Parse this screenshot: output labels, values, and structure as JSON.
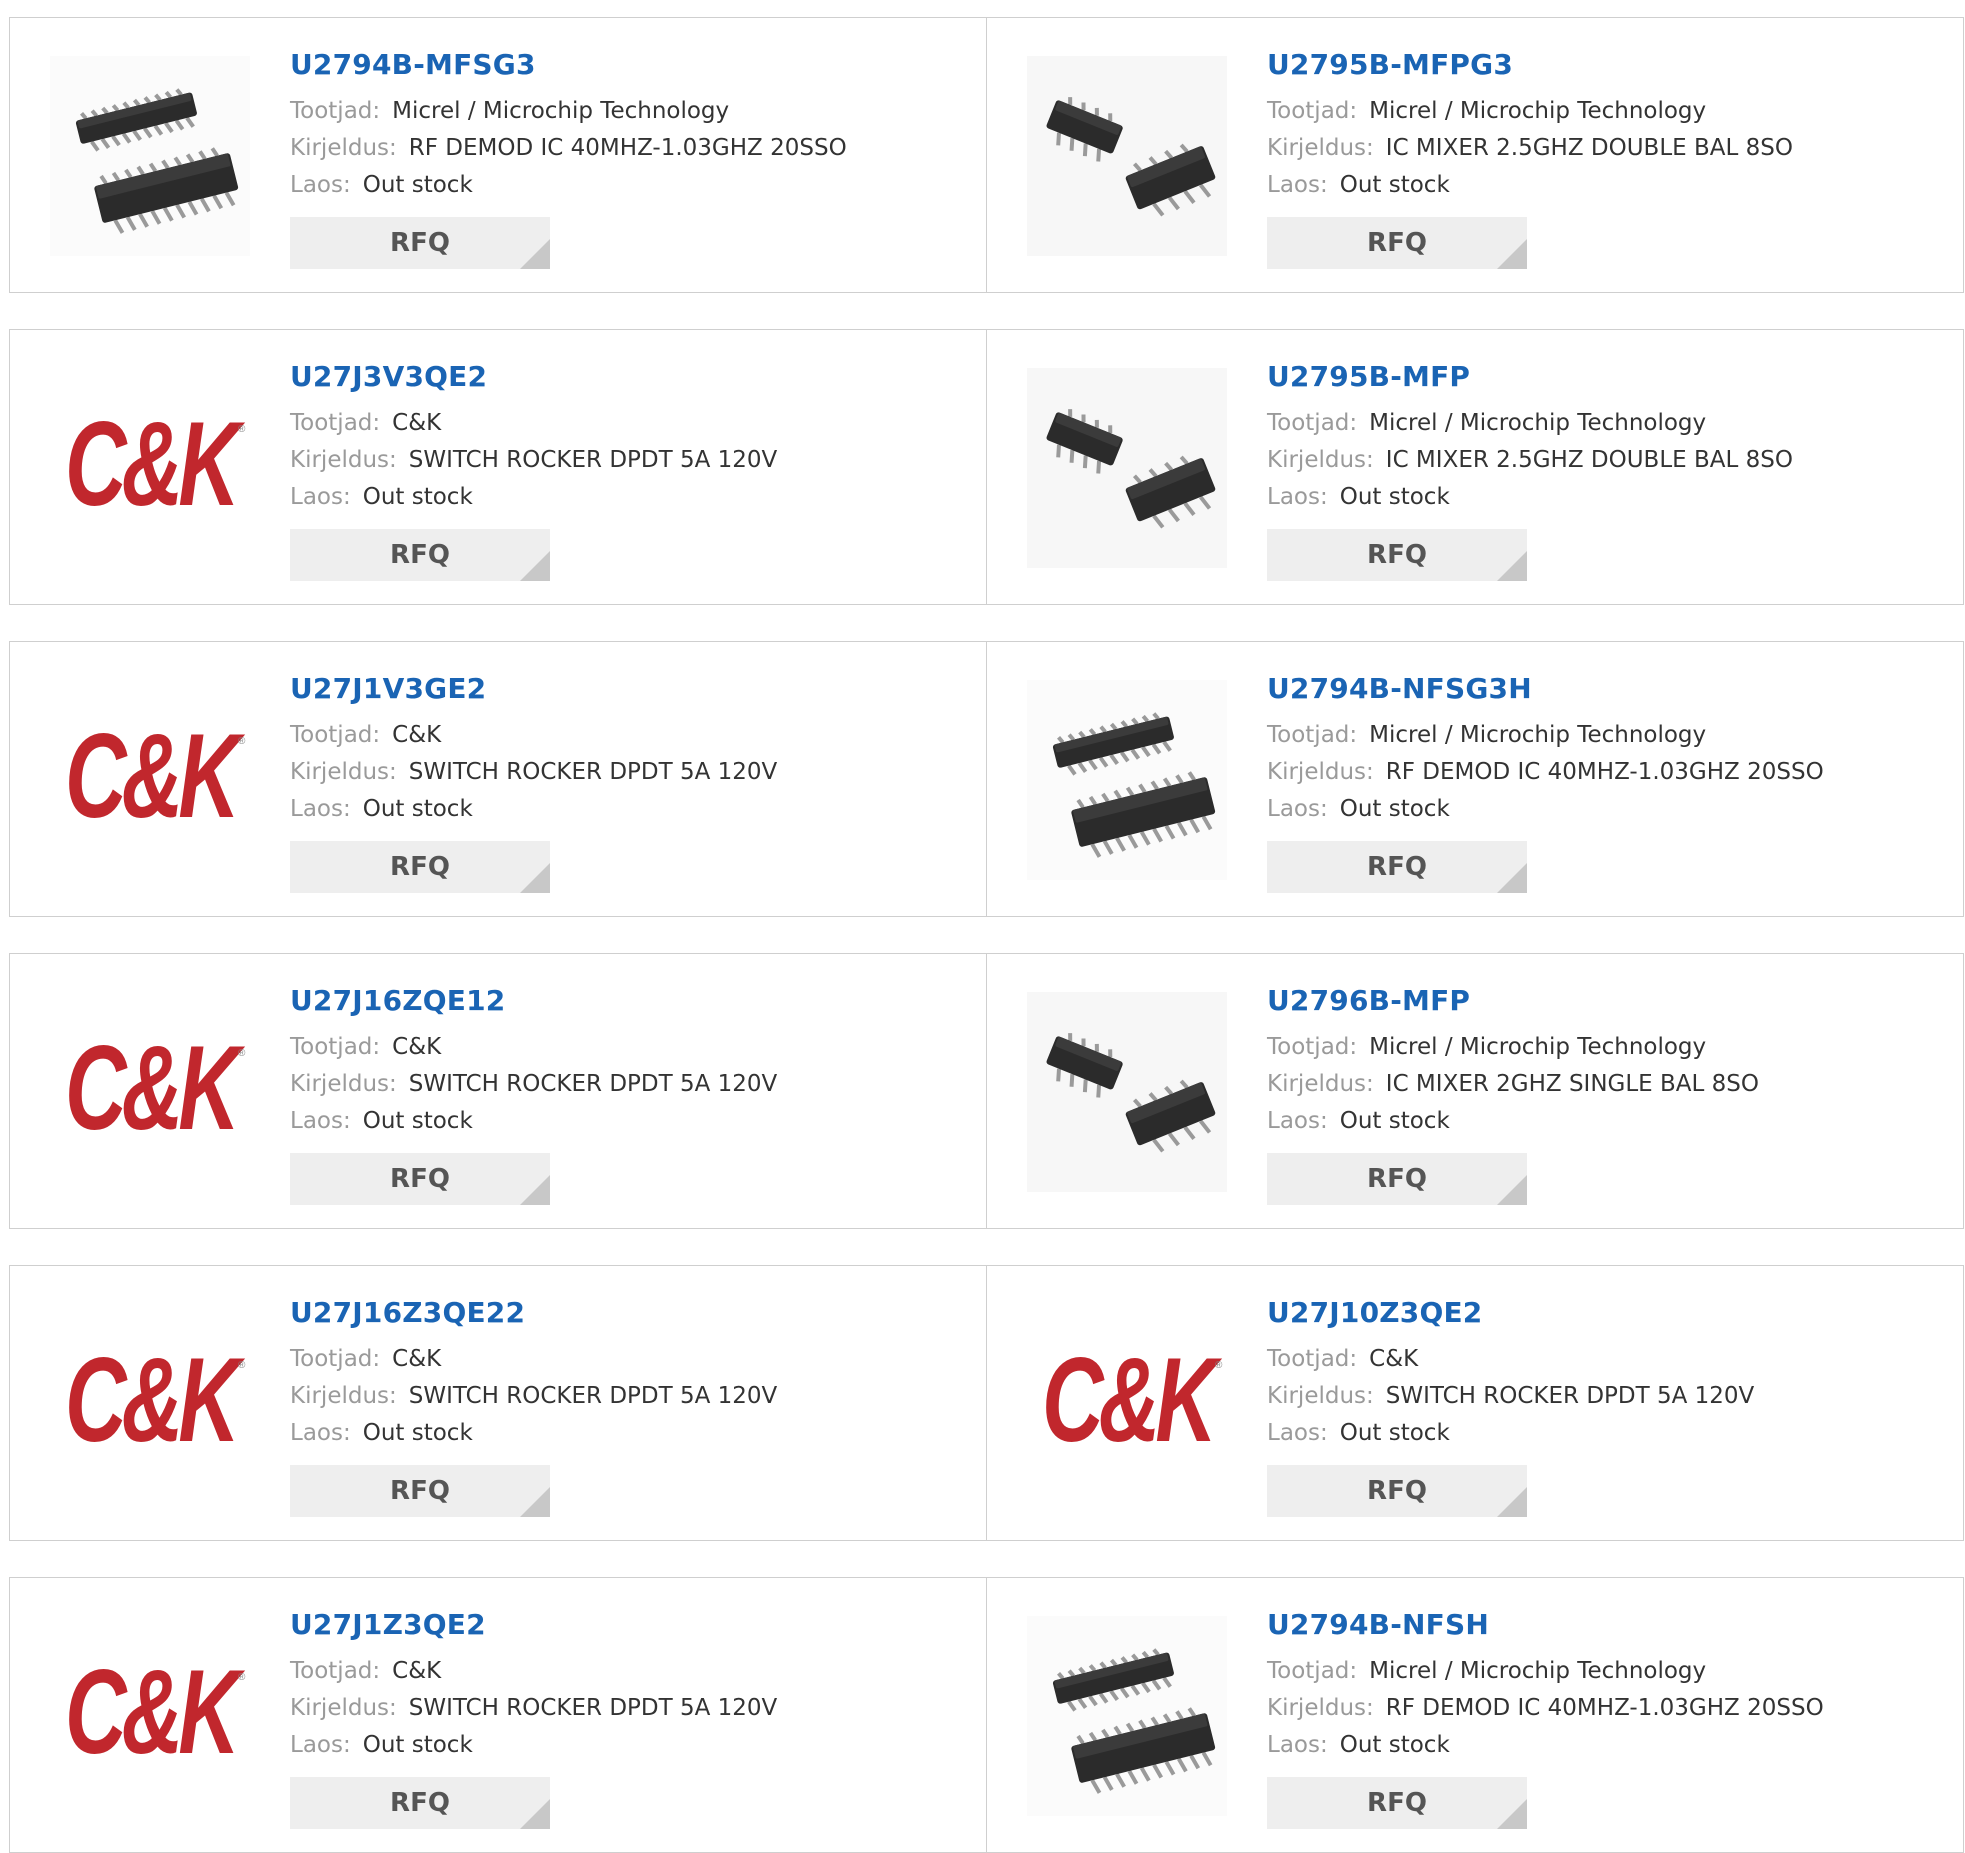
{
  "labels": {
    "maker": "Tootjad:",
    "desc": "Kirjeldus:",
    "stock": "Laos:",
    "rfq": "RFQ"
  },
  "colors": {
    "link": "#1a64b4",
    "ck_red": "#c1272d",
    "chip": "#2b2b2b"
  },
  "products": [
    {
      "part": "U2794B-MFSG3",
      "maker": "Micrel / Microchip Technology",
      "desc": "RF DEMOD IC 40MHZ-1.03GHZ 20SSO",
      "stock": "Out stock",
      "image": "chip-ssop20-icon"
    },
    {
      "part": "U2795B-MFPG3",
      "maker": "Micrel / Microchip Technology",
      "desc": "IC MIXER 2.5GHZ DOUBLE BAL 8SO",
      "stock": "Out stock",
      "image": "chip-so8-icon"
    },
    {
      "part": "U27J3V3QE2",
      "maker": "C&K",
      "desc": "SWITCH ROCKER DPDT 5A 120V",
      "stock": "Out stock",
      "image": "ck-logo"
    },
    {
      "part": "U2795B-MFP",
      "maker": "Micrel / Microchip Technology",
      "desc": "IC MIXER 2.5GHZ DOUBLE BAL 8SO",
      "stock": "Out stock",
      "image": "chip-so8-icon"
    },
    {
      "part": "U27J1V3GE2",
      "maker": "C&K",
      "desc": "SWITCH ROCKER DPDT 5A 120V",
      "stock": "Out stock",
      "image": "ck-logo"
    },
    {
      "part": "U2794B-NFSG3H",
      "maker": "Micrel / Microchip Technology",
      "desc": "RF DEMOD IC 40MHZ-1.03GHZ 20SSO",
      "stock": "Out stock",
      "image": "chip-ssop20-icon"
    },
    {
      "part": "U27J16ZQE12",
      "maker": "C&K",
      "desc": "SWITCH ROCKER DPDT 5A 120V",
      "stock": "Out stock",
      "image": "ck-logo"
    },
    {
      "part": "U2796B-MFP",
      "maker": "Micrel / Microchip Technology",
      "desc": "IC MIXER 2GHZ SINGLE BAL 8SO",
      "stock": "Out stock",
      "image": "chip-so8-icon"
    },
    {
      "part": "U27J16Z3QE22",
      "maker": "C&K",
      "desc": "SWITCH ROCKER DPDT 5A 120V",
      "stock": "Out stock",
      "image": "ck-logo"
    },
    {
      "part": "U27J10Z3QE2",
      "maker": "C&K",
      "desc": "SWITCH ROCKER DPDT 5A 120V",
      "stock": "Out stock",
      "image": "ck-logo"
    },
    {
      "part": "U27J1Z3QE2",
      "maker": "C&K",
      "desc": "SWITCH ROCKER DPDT 5A 120V",
      "stock": "Out stock",
      "image": "ck-logo"
    },
    {
      "part": "U2794B-NFSH",
      "maker": "Micrel / Microchip Technology",
      "desc": "RF DEMOD IC 40MHZ-1.03GHZ 20SSO",
      "stock": "Out stock",
      "image": "chip-ssop20-icon"
    }
  ]
}
